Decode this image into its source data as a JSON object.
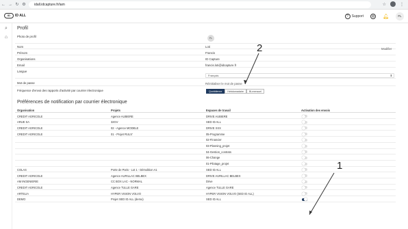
{
  "browser": {
    "url": "idall.idcapture.fr/iam",
    "back_icon": "arrow-left",
    "forward_icon": "arrow-right",
    "reload_icon": "reload",
    "info_icon": "site-info",
    "star_icon": "star",
    "menu_icon": "more-vert"
  },
  "header": {
    "logo_text": "ID ALL",
    "support_label": "Support",
    "avatar_initials": "FL"
  },
  "profil": {
    "title": "Profil",
    "photo_label": "Photo de profil",
    "photo_initials": "FL",
    "modifier_label": "Modifier",
    "fields": [
      {
        "label": "Nom",
        "value": "Loti"
      },
      {
        "label": "Prénom",
        "value": "Francis"
      },
      {
        "label": "Organisations",
        "value": "ID Capture"
      },
      {
        "label": "Email",
        "value": "francis.loti@idcapture.fr"
      },
      {
        "label": "Langue",
        "value": ""
      },
      {
        "label": "Mot de passe",
        "value": ""
      },
      {
        "label": "Fréquence d'envoi des rapports d'activité par courrier électronique",
        "value": ""
      }
    ],
    "language_value": "Français",
    "reset_password_label": "Réinitialiser le mot de passe",
    "frequency_options": [
      "Quotidienne",
      "Hebdomadaire",
      "Bi-mensuel"
    ],
    "frequency_selected": "Quotidienne"
  },
  "notifications": {
    "title": "Préférences de notification par courrier électronique",
    "columns": [
      "Organisation",
      "Projets",
      "Espaces de travail",
      "Activation des envois"
    ],
    "rows": [
      {
        "org": "CREDIT AGRICOLE",
        "project": "Agence AUBIERE",
        "workspace": "DRIVE AUBIERE",
        "on": false
      },
      {
        "org": "ARUE SA",
        "project": "32GV",
        "workspace": "SED ID ALL",
        "on": false
      },
      {
        "org": "CREDIT AGRICOLE",
        "project": "02 - Agence MODELE",
        "workspace": "DRIVE XXX",
        "on": false
      },
      {
        "org": "CREDIT AGRICOLE",
        "project": "01 - Projet RULS'",
        "workspace": "05-Programme",
        "on": false
      },
      {
        "org": "",
        "project": "",
        "workspace": "02-Financier",
        "on": false
      },
      {
        "org": "",
        "project": "",
        "workspace": "03-Planning_projet",
        "on": false
      },
      {
        "org": "",
        "project": "",
        "workspace": "04-Gestion_contrats",
        "on": false
      },
      {
        "org": "",
        "project": "",
        "workspace": "06-Change",
        "on": false
      },
      {
        "org": "",
        "project": "",
        "workspace": "01-Pilotage_projet",
        "on": false
      },
      {
        "org": "COLAS",
        "project": "Porte de Paris - Lot 1 - Démolition A1",
        "workspace": "SED ID ALL",
        "on": false
      },
      {
        "org": "CREDIT AGRICOLE",
        "project": "Agence AURILLAC BELBEX",
        "workspace": "DRIVE AURILLAC BELBEX",
        "on": false
      },
      {
        "org": "AM INGENIERIE",
        "project": "CC BOX LAC - NORMAL",
        "workspace": "Drive",
        "on": false
      },
      {
        "org": "CREDIT AGRICOLE",
        "project": "Agence TULLE GARE",
        "workspace": "Agence TULLE GARE",
        "on": false
      },
      {
        "org": "ARTELIA",
        "project": "HYPER VISION VOLVO",
        "workspace": "HYPER VISION VOLVO (SED ID ALL)",
        "on": false
      },
      {
        "org": "DEMO",
        "project": "Projet SED ID ALL (demo)",
        "workspace": "SED ID ALL",
        "on": true
      }
    ]
  },
  "annotations": {
    "one": "1",
    "two": "2"
  },
  "colors": {
    "accent": "#1f3a5f",
    "annotation": "#c0392b",
    "bell": "#f2b300"
  }
}
